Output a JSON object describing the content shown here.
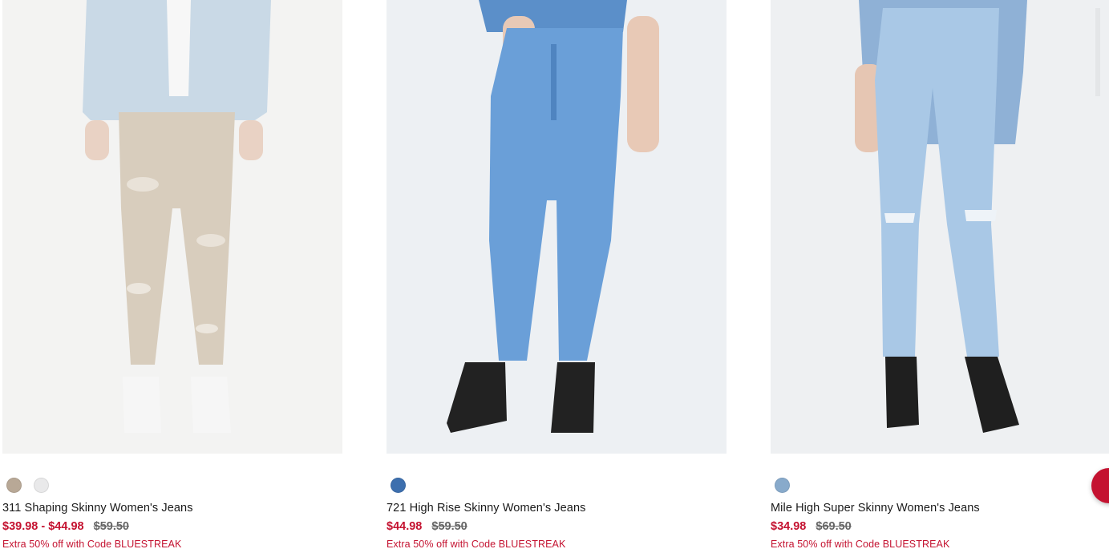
{
  "products": [
    {
      "name": "311 Shaping Skinny Women's Jeans",
      "price": "$39.98 - $44.98",
      "original_price": "$59.50",
      "promo": "Extra 50% off with Code BLUESTREAK",
      "swatches": [
        "#b8a896",
        "#e9e9ea"
      ]
    },
    {
      "name": "721 High Rise Skinny Women's Jeans",
      "price": "$44.98",
      "original_price": "$59.50",
      "promo": "Extra 50% off with Code BLUESTREAK",
      "swatches": [
        "#3d6fae"
      ]
    },
    {
      "name": "Mile High Super Skinny Women's Jeans",
      "price": "$34.98",
      "original_price": "$69.50",
      "promo": "Extra 50% off with Code BLUESTREAK",
      "swatches": [
        "#88aacb"
      ]
    }
  ],
  "colors": {
    "sale": "#c41230",
    "chat_button": "#c41230"
  }
}
